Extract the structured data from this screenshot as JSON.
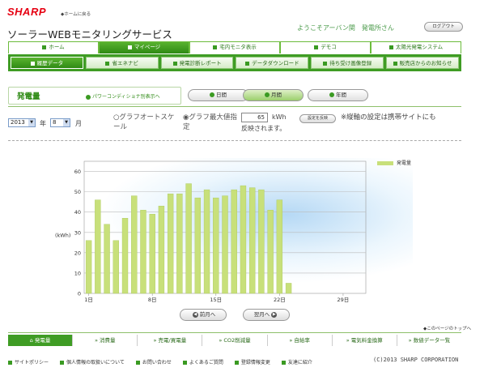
{
  "header": {
    "logo": "SHARP",
    "home_link": "◆ホームに戻る",
    "site_title": "ソーラーWEBモニタリングサービス",
    "welcome": "ようこそアーバン関　発電所さん",
    "logout": "ログアウト"
  },
  "main_nav": [
    {
      "label": "ホーム",
      "active": false
    },
    {
      "label": "マイページ",
      "active": true
    },
    {
      "label": "宅内モニタ表示",
      "active": false
    },
    {
      "label": "デモコ",
      "active": false
    },
    {
      "label": "太陽光発電システム",
      "active": false
    }
  ],
  "sub_nav": [
    {
      "label": "履歴データ",
      "active": true
    },
    {
      "label": "省エネナビ",
      "active": false
    },
    {
      "label": "発電診断レポート",
      "active": false
    },
    {
      "label": "データダウンロード",
      "active": false
    },
    {
      "label": "待ち受け画像登録",
      "active": false
    },
    {
      "label": "販売店からのお知らせ",
      "active": false
    }
  ],
  "section": {
    "title": "発電量",
    "pcs_link": "パワーコンディショナ別表示へ"
  },
  "period_buttons": [
    {
      "label": "日間",
      "selected": false
    },
    {
      "label": "月間",
      "selected": true
    },
    {
      "label": "年間",
      "selected": false
    }
  ],
  "date_select": {
    "year": "2013",
    "year_label": "年",
    "month": "8",
    "month_label": "月"
  },
  "scale": {
    "auto_label": "グラフオートスケール",
    "max_label": "グラフ最大値指定",
    "max_value": "65",
    "unit": "kWh",
    "reflect_label": "反映されます。",
    "set_button": "設定を反映",
    "note": "※縦軸の設定は携帯サイトにも"
  },
  "chart_data": {
    "type": "bar",
    "ylabel": "(kWh)",
    "ylim": [
      0,
      65
    ],
    "yticks": [
      "0",
      "10",
      "20",
      "30",
      "40",
      "50",
      "60"
    ],
    "xticks": [
      "1日",
      "8日",
      "15日",
      "22日",
      "29日"
    ],
    "xtick_days": [
      1,
      8,
      15,
      22,
      29
    ],
    "days_in_month": 31,
    "legend": "発電量",
    "bar_color": "#c8e07a",
    "values": [
      26,
      46,
      34,
      26,
      37,
      48,
      41,
      39,
      43,
      49,
      49,
      54,
      47,
      51,
      47,
      48,
      51,
      53,
      52,
      51,
      41,
      46,
      5
    ]
  },
  "month_nav": {
    "prev": "前月へ",
    "next": "翌月へ",
    "to_top": "◆このページのトップへ"
  },
  "bottom_nav": [
    {
      "label": "発電量",
      "active": true
    },
    {
      "label": "消費量",
      "active": false
    },
    {
      "label": "売電/買電量",
      "active": false
    },
    {
      "label": "CO2削減量",
      "active": false
    },
    {
      "label": "自給率",
      "active": false
    },
    {
      "label": "電気料金換算",
      "active": false
    },
    {
      "label": "数値データ一覧",
      "active": false
    }
  ],
  "footer": {
    "links": [
      "サイトポリシー",
      "個人情報の取扱いについて",
      "お問い合わせ",
      "よくあるご質問",
      "登録情報変更",
      "友達に紹介"
    ],
    "copyright": "(C)2013 SHARP CORPORATION"
  }
}
